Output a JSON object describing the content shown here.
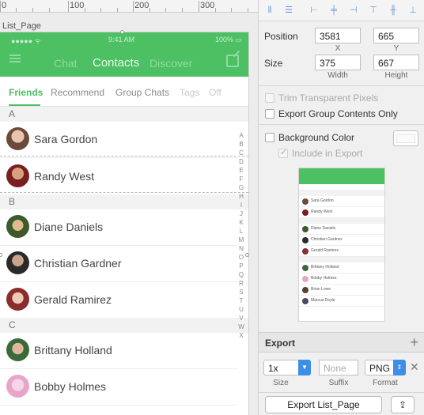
{
  "ruler": {
    "labels": [
      "0",
      "100",
      "200",
      "300"
    ]
  },
  "artboard": {
    "name": "List_Page"
  },
  "phone": {
    "status_time": "9:41 AM",
    "status_signal": "●●●●● ᯤ",
    "status_battery": "100% ▭",
    "nav_tabs": [
      "Chat",
      "Contacts",
      "Discover"
    ],
    "subtabs": [
      "Friends",
      "Recommend",
      "Group Chats",
      "Tags",
      "Off"
    ],
    "sections": [
      {
        "letter": "A",
        "contacts": [
          "Sara Gordon",
          "Randy West"
        ]
      },
      {
        "letter": "B",
        "contacts": [
          "Diane Daniels",
          "Christian Gardner",
          "Gerald Ramirez"
        ]
      },
      {
        "letter": "C",
        "contacts": [
          "Brittany Holland",
          "Bobby Holmes"
        ]
      }
    ],
    "index_letters": [
      "A",
      "B",
      "C",
      "D",
      "E",
      "F",
      "G",
      "H",
      "I",
      "J",
      "K",
      "L",
      "M",
      "N",
      "O",
      "P",
      "Q",
      "R",
      "S",
      "T",
      "U",
      "V",
      "W",
      "X"
    ]
  },
  "inspector": {
    "position_label": "Position",
    "position_x": "3581",
    "position_y": "665",
    "x_label": "X",
    "y_label": "Y",
    "size_label": "Size",
    "width": "375",
    "height": "667",
    "width_label": "Width",
    "height_label": "Height",
    "trim_label": "Trim Transparent Pixels",
    "export_group_label": "Export Group Contents Only",
    "background_color_label": "Background Color",
    "include_export_label": "Include in Export",
    "preview_names": [
      "Sara Gordon",
      "Randy West",
      "Diane Daniels",
      "Christian Gardner",
      "Gerald Ramirez",
      "Brittany Holland",
      "Bobby Holmes",
      "Brian Lowe",
      "Marcus Doyle"
    ],
    "export_title": "Export",
    "scale_value": "1x",
    "suffix_placeholder": "None",
    "format_value": "PNG",
    "scale_label": "Size",
    "suffix_label": "Suffix",
    "format_label": "Format",
    "export_button": "Export List_Page"
  },
  "colors": {
    "brand_green": "#4cc063",
    "accent_blue": "#3d8ee6"
  }
}
